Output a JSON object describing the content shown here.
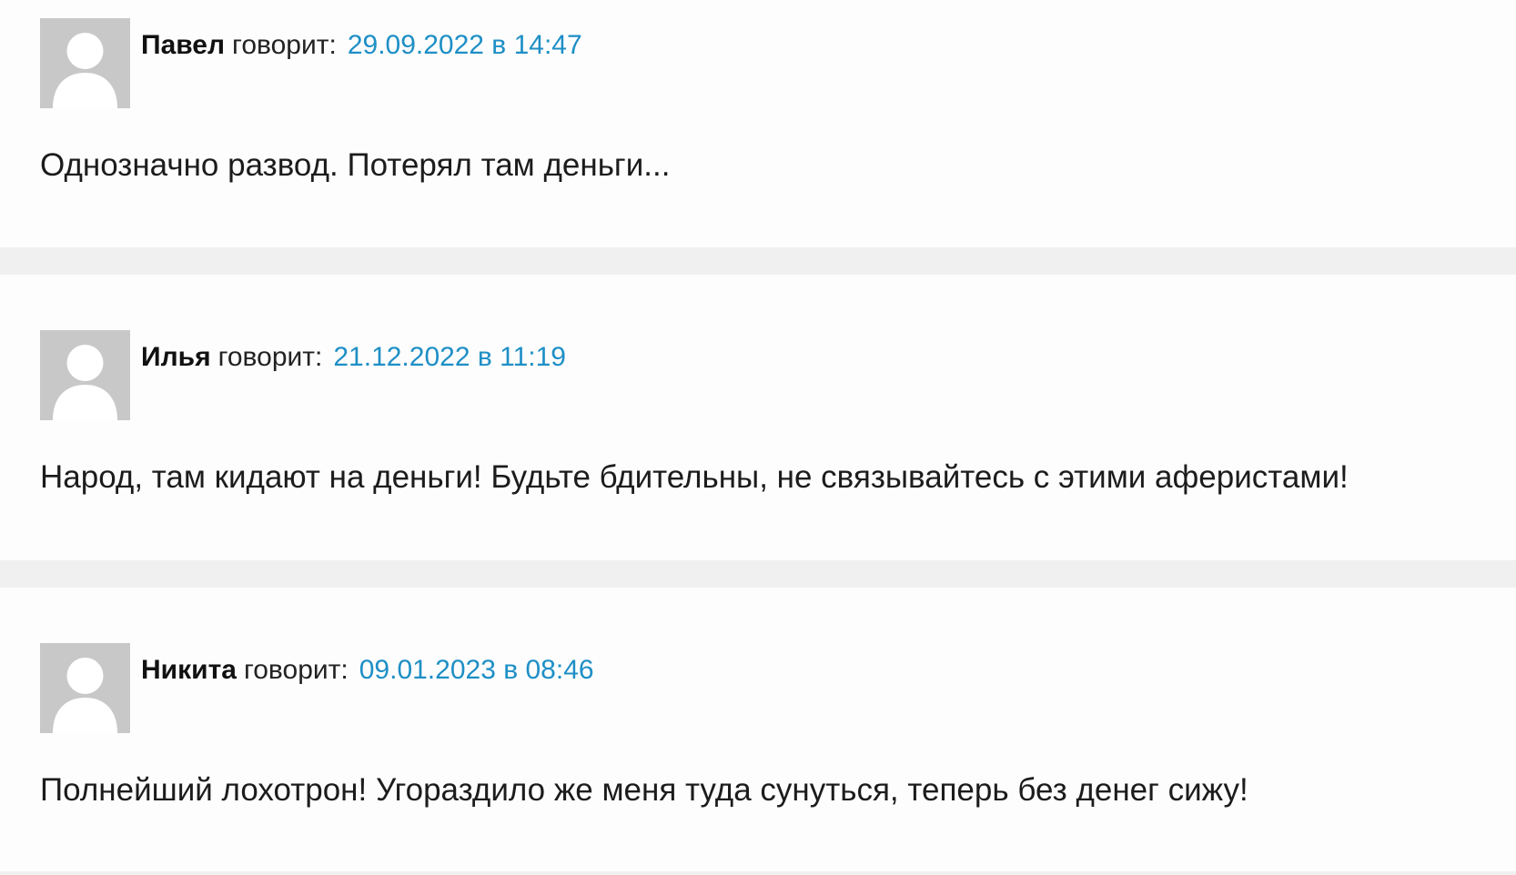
{
  "comments": [
    {
      "author": "Павел",
      "says": "говорит:",
      "date": "29.09.2022 в 14:47",
      "text": "Однозначно развод. Потерял там деньги..."
    },
    {
      "author": "Илья",
      "says": "говорит:",
      "date": "21.12.2022 в 11:19",
      "text": "Народ, там кидают на деньги! Будьте бдительны, не связывайтесь с этими аферистами!"
    },
    {
      "author": "Никита",
      "says": "говорит:",
      "date": "09.01.2023 в 08:46",
      "text": "Полнейший лохотрон! Угораздило же меня туда сунуться, теперь без денег сижу!"
    }
  ],
  "colors": {
    "link": "#1e8fc6",
    "avatar_bg": "#c8c8c8",
    "avatar_figure": "#ffffff",
    "card_bg": "#fdfdfd",
    "page_bg": "#f0f0f0"
  }
}
